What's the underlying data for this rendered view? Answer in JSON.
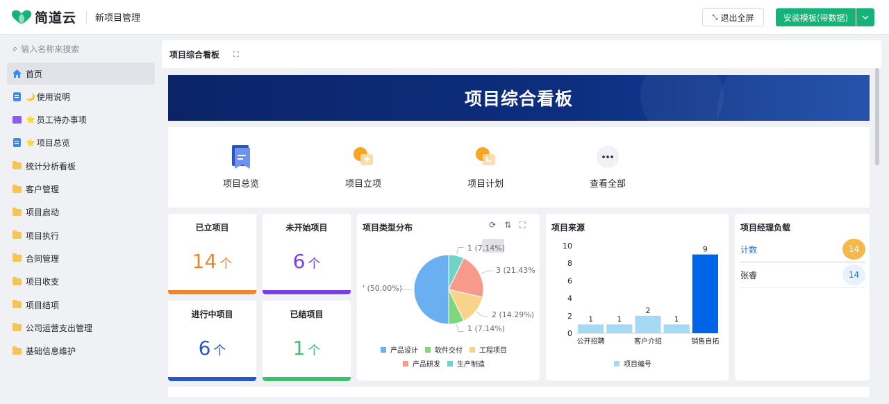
{
  "header": {
    "brand": "简道云",
    "app_title": "新项目管理",
    "exit_fullscreen": "退出全屏",
    "install_template": "安装模板(带数据)"
  },
  "sidebar": {
    "search_placeholder": "输入名称来搜索",
    "items": [
      {
        "label": "首页",
        "icon": "home-icon",
        "active": true
      },
      {
        "label": "使用说明",
        "icon": "doc-icon",
        "emoji": "🌙"
      },
      {
        "label": "员工待办事项",
        "icon": "chart-icon",
        "emoji": "⭐"
      },
      {
        "label": "项目总览",
        "icon": "doc-icon",
        "emoji": "⭐"
      },
      {
        "label": "统计分析看板",
        "icon": "folder-icon"
      },
      {
        "label": "客户管理",
        "icon": "folder-icon"
      },
      {
        "label": "项目启动",
        "icon": "folder-icon"
      },
      {
        "label": "项目执行",
        "icon": "folder-icon"
      },
      {
        "label": "合同管理",
        "icon": "folder-icon"
      },
      {
        "label": "项目收支",
        "icon": "folder-icon"
      },
      {
        "label": "项目结项",
        "icon": "folder-icon"
      },
      {
        "label": "公司运营支出管理",
        "icon": "folder-icon"
      },
      {
        "label": "基础信息维护",
        "icon": "folder-icon"
      }
    ]
  },
  "main": {
    "title": "项目综合看板",
    "banner_title": "项目综合看板",
    "shortcuts": [
      {
        "label": "项目总览"
      },
      {
        "label": "项目立项"
      },
      {
        "label": "项目计划"
      },
      {
        "label": "查看全部"
      }
    ],
    "stats": [
      {
        "title": "已立项目",
        "value": "14",
        "unit": "个",
        "color": "#f0862a"
      },
      {
        "title": "未开始项目",
        "value": "6",
        "unit": "个",
        "color": "#7b3fe4"
      },
      {
        "title": "进行中项目",
        "value": "6",
        "unit": "个",
        "color": "#2a55c6"
      },
      {
        "title": "已结项目",
        "value": "1",
        "unit": "个",
        "color": "#3fbf6f"
      }
    ],
    "pie": {
      "title": "项目类型分布",
      "labels": [
        "1 (7.14%)",
        "3 (21.43%",
        "2 (14.29%)",
        "1 (7.14%)",
        "' (50.00%)"
      ]
    },
    "bar": {
      "title": "项目来源",
      "legend": "项目编号"
    },
    "managers": {
      "title": "项目经理负载",
      "rows": [
        {
          "name": "计数",
          "value": "14"
        },
        {
          "name": "张睿",
          "value": "14"
        }
      ]
    }
  },
  "chart_data": [
    {
      "type": "pie",
      "title": "项目类型分布",
      "categories": [
        "产品设计",
        "产品研发",
        "工程项目",
        "软件交付",
        "生产制造"
      ],
      "values": [
        7,
        3,
        2,
        1,
        1
      ],
      "colors": [
        "#6aaff0",
        "#f79a8c",
        "#f8d48a",
        "#7ed67e",
        "#6fd4c8"
      ],
      "legend_position": "bottom"
    },
    {
      "type": "bar",
      "title": "项目来源",
      "categories": [
        "公开招聘",
        "",
        "客户介绍",
        "",
        "销售自拓"
      ],
      "series": [
        {
          "name": "项目编号",
          "values": [
            1,
            1,
            2,
            1,
            9
          ]
        }
      ],
      "highlight_index": 4,
      "ylim": [
        0,
        10
      ],
      "yticks": [
        0,
        2,
        4,
        6,
        8,
        10
      ],
      "bar_color": "#a6d9f2",
      "highlight_color": "#0064e6",
      "legend_position": "bottom"
    }
  ]
}
